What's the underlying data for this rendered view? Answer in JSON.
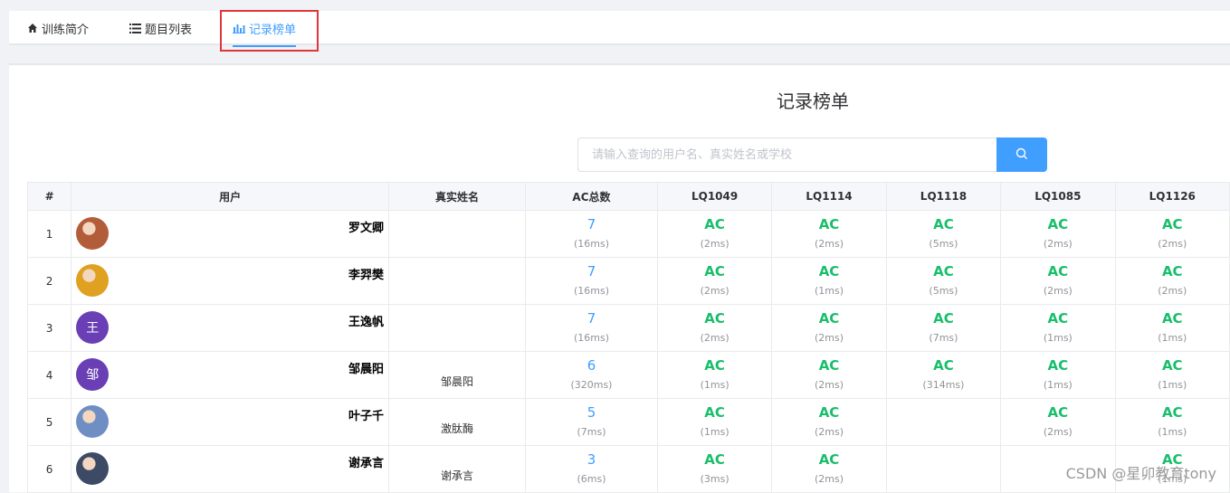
{
  "tabs": [
    {
      "label": "训练简介",
      "icon": "home-icon",
      "active": false
    },
    {
      "label": "题目列表",
      "icon": "list-icon",
      "active": false
    },
    {
      "label": "记录榜单",
      "icon": "bar-chart-icon",
      "active": true
    }
  ],
  "page_title": "记录榜单",
  "search": {
    "placeholder": "请输入查询的用户名、真实姓名或学校",
    "value": ""
  },
  "table": {
    "headers": [
      "#",
      "用户",
      "真实姓名",
      "AC总数",
      "LQ1049",
      "LQ1114",
      "LQ1118",
      "LQ1085",
      "LQ1126"
    ],
    "rows": [
      {
        "rank": "1",
        "user": "罗文卿",
        "realname": "",
        "avatar": {
          "type": "image",
          "color": "#b35c3a",
          "text": ""
        },
        "ac": "7",
        "time": "(16ms)",
        "cells": [
          [
            "AC",
            "(2ms)"
          ],
          [
            "AC",
            "(2ms)"
          ],
          [
            "AC",
            "(5ms)"
          ],
          [
            "AC",
            "(2ms)"
          ],
          [
            "AC",
            "(2ms)"
          ]
        ]
      },
      {
        "rank": "2",
        "user": "李羿樊",
        "realname": "",
        "avatar": {
          "type": "image",
          "color": "#e0a020",
          "text": ""
        },
        "ac": "7",
        "time": "(16ms)",
        "cells": [
          [
            "AC",
            "(2ms)"
          ],
          [
            "AC",
            "(1ms)"
          ],
          [
            "AC",
            "(5ms)"
          ],
          [
            "AC",
            "(2ms)"
          ],
          [
            "AC",
            "(2ms)"
          ]
        ]
      },
      {
        "rank": "3",
        "user": "王逸帆",
        "realname": "",
        "avatar": {
          "type": "letter",
          "color": "#6a3fb5",
          "text": "王"
        },
        "ac": "7",
        "time": "(16ms)",
        "cells": [
          [
            "AC",
            "(2ms)"
          ],
          [
            "AC",
            "(2ms)"
          ],
          [
            "AC",
            "(7ms)"
          ],
          [
            "AC",
            "(1ms)"
          ],
          [
            "AC",
            "(1ms)"
          ]
        ]
      },
      {
        "rank": "4",
        "user": "邹晨阳",
        "realname": "邹晨阳",
        "avatar": {
          "type": "letter",
          "color": "#6a3fb5",
          "text": "邹"
        },
        "ac": "6",
        "time": "(320ms)",
        "cells": [
          [
            "AC",
            "(1ms)"
          ],
          [
            "AC",
            "(2ms)"
          ],
          [
            "AC",
            "(314ms)"
          ],
          [
            "AC",
            "(1ms)"
          ],
          [
            "AC",
            "(1ms)"
          ]
        ]
      },
      {
        "rank": "5",
        "user": "叶子千",
        "realname": "激肽酶",
        "avatar": {
          "type": "image",
          "color": "#6f8fc4",
          "text": ""
        },
        "ac": "5",
        "time": "(7ms)",
        "cells": [
          [
            "AC",
            "(1ms)"
          ],
          [
            "AC",
            "(2ms)"
          ],
          [
            "",
            ""
          ],
          [
            "AC",
            "(2ms)"
          ],
          [
            "AC",
            "(1ms)"
          ]
        ]
      },
      {
        "rank": "6",
        "user": "谢承言",
        "realname": "谢承言",
        "avatar": {
          "type": "image",
          "color": "#3d4a66",
          "text": ""
        },
        "ac": "3",
        "time": "(6ms)",
        "cells": [
          [
            "AC",
            "(3ms)"
          ],
          [
            "AC",
            "(2ms)"
          ],
          [
            "",
            ""
          ],
          [
            "",
            ""
          ],
          [
            "AC",
            "(1ms)"
          ]
        ]
      }
    ]
  },
  "watermark": "CSDN @星卯教育tony",
  "colors": {
    "accent": "#409eff",
    "ac_green": "#19be6b",
    "highlight": "#e0353a"
  }
}
